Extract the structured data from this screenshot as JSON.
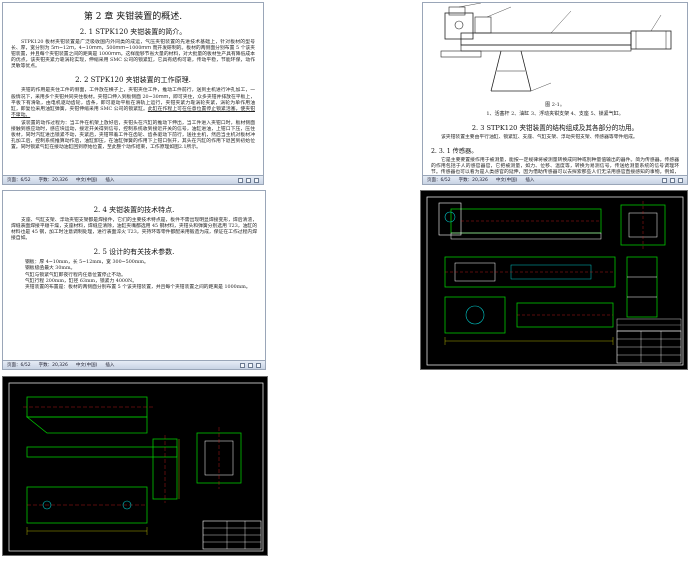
{
  "page1": {
    "chapter_title": "第 2 章  夹钳装置的概述.",
    "sec_2_1_title": "2. 1  STPK120 夹钳装置的简介。",
    "sec_2_1_body": "STPK120 板材夹钳装置是广泛吸收国内外同类的成运，气压夹钳装置的先进技术基础上，针对板材的型号长、厚，宽分别为 5ｍ~12ｍ，4~10ｍｍ，500ｍｍ~1000ｍｍ 而开发研制的。板材的两侧面分别布置 5 个该夹钳装置，并且每个夹钳装置之间的距离是 1000ｍｍ。这样能够节省大量的材料，对大批量的板材生产具有降低成本的优点，该夹钳夹紧力靠涡轮实现，伸缩采用 SMC 公司的锁紧缸，它具有结构可靠，传动平稳，节能环保，动作灵敏等优点。",
    "sec_2_2_title": "2. 2  STPK120 夹钳装置的工作原理.",
    "sec_2_2_body1": "夹钳的作用是夹住工件的侧面，工件放在横子上，夹钳夹住工件，推动工件前行，送到主机进行冲孔加工，一般情况下，采用多个夹钳共同夹住板材。夹钳口伸入到板侧面 20~30ｍｍ，即可夹住，众多夹钳并排放在平板上，平板下有滑轨，由电机驱动齿轮，齿条，即可驱动平板在滑轨上运行，夹钳夹紧力靠涡轮夹紧，涡轮为单作用油缸，即复位采用油缸弹簧，夹钳伸缩采用 SMC 公司的锁紧缸。",
    "sec_2_2_body1_tail": "此缸在作程上可在任意位置停止锁紧活塞，使夹钳不窜动。",
    "sec_2_2_body2": "该装置的动作过程为：当工件在机架上放好后，夹钳头在汽缸的推动下伸出，当工件进入夹钳口时，板材侧面接触到感应动时，感应块运动，接近开关得到信号，控制系统收到接近开关的信号，油缸进油，上钳口下压，压住板材，同时汽缸进出锁紧不动，夹紧后，夹钳带着工件在齿轮、齿条驱动下前行，送往主机，然后当主机对板材冲孔加工后，控制系统推算动作后，油缸卸压，在油缸弹簧的作用下上钳口张开，其头在汽缸的作用下退回到初始位置。同时锁紧气缸在接动油缸回到原始位置，至此整个动作结束，工作原理如图2.1所示。"
  },
  "page2": {
    "figure_caption": "图 2-1。",
    "figure_legend": "1、活塞杆  2、油缸  3、浮动夹钳支架  4、支座  5、锁紧气缸。",
    "sec_2_3_title": "2. 3  STPK120 夹钳装置的结构组成及其各部分的功用。",
    "sec_2_3_body": "该夹钳装置主要由平行油缸、锁紧缸、支座、气缸支架、浮动夹钳支架、传感器等零件组成。",
    "sec_2_3_1_title": "2. 3. 1  传感器。",
    "sec_2_3_1_body": "它是主要要置接作用于被测量，能按一定规律将被测量转换成同种或别种量值输出的器件。简为传感器。传感器的作用包括于人的感官器官，它把被测量，如力、位移、温度等，转换为易测信号，传送给测量系统的信号调理环节。传感器也可以看为是人类感官的延伸，因为借助传感器可以去探索那些人们无法用感官直接感知的事物。例如，用热电偶可以测量炽热的物体的温度；"
  },
  "page3": {
    "top_text": "…",
    "sec_2_4_title": "2. 4  夹钳装置的技术特点.",
    "sec_2_4_body": "支座、气缸支架、浮动夹钳支架都是焊接件，它们的主要技术特点是，板件不需出现明显焊接变形，焊后清渣，焊缝表面焊接平顺干燥，支座材料，焊缝应清除，油缸夹嘴都选用 45 钢材料，夹钳头和弹簧分别选用 T23，油缸的材料也是 45 钢，加工时注意调制处理，进行表面淬火 T23，夹持环等零件都配采用锻造为成，保证在工作过程内焊接自如。",
    "sec_2_5_title": "2. 5  设计的有关技术参数.",
    "params": [
      "钢板：厚 4~10mm，长 5~12mm，宽 300~500mm。",
      "钢板极函最大 30mm。",
      "气缸与锁紧气缸即夜行程内任意位置停止不动。",
      "气缸行程 200mm，缸径 63mm，锁紧力 4000N。",
      "夹钳装置的布置是：板材的两侧面分别布置 5 个该夹钳装置，并且每个夹钳装置之间的距离是 1000mm。"
    ]
  },
  "statusbar": {
    "page": "页面：6/52",
    "words": "字数：20,326",
    "lang": "中文(中国)",
    "mode": "插入"
  },
  "colors": {
    "cad_background": "#000000",
    "cad_green": "#00c800",
    "cad_white": "#ffffff",
    "cad_cyan": "#00c8c8",
    "cad_red": "#e02020",
    "cad_yellow": "#d8d800",
    "panel_border": "#9aa6b8"
  }
}
